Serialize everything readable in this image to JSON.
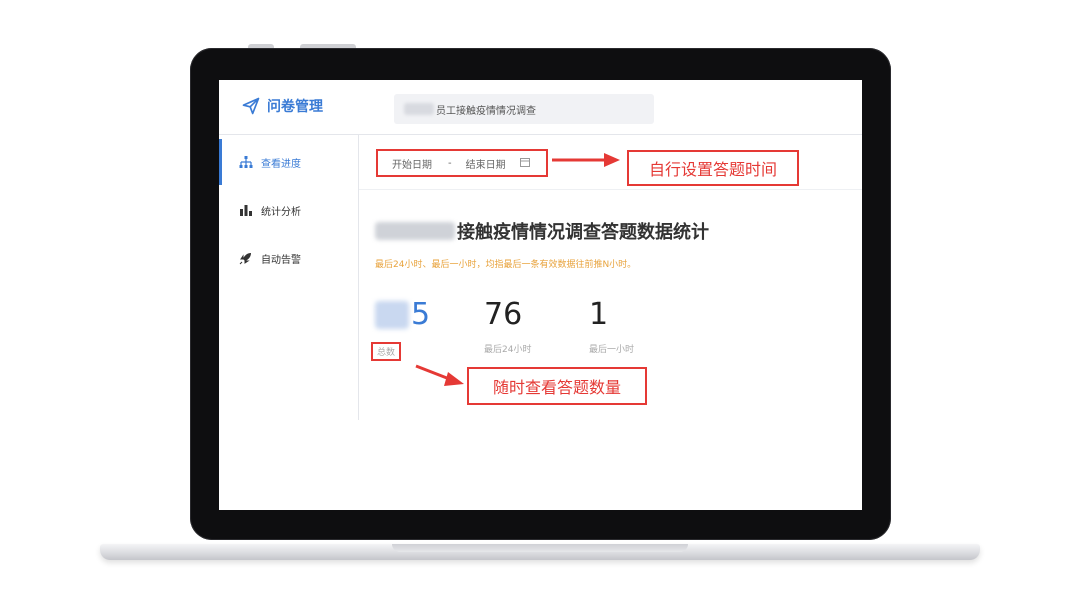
{
  "app": {
    "title": "问卷管理"
  },
  "search": {
    "value": "员工接触疫情情况调查"
  },
  "sidebar": {
    "items": [
      {
        "label": "查看进度",
        "icon": "sitemap-icon",
        "active": true
      },
      {
        "label": "统计分析",
        "icon": "bar-chart-icon",
        "active": false
      },
      {
        "label": "自动告警",
        "icon": "rocket-icon",
        "active": false
      }
    ]
  },
  "filter": {
    "start_placeholder": "开始日期",
    "separator": "-",
    "end_placeholder": "结束日期",
    "icon": "calendar-icon"
  },
  "main": {
    "title": "接触疫情情况调查答题数据统计",
    "hint": "最后24小时、最后一小时，均指最后一条有效数据往前推N小时。",
    "stats": [
      {
        "value": "5",
        "label": "总数"
      },
      {
        "value": "76",
        "label": "最后24小时"
      },
      {
        "value": "1",
        "label": "最后一小时"
      }
    ]
  },
  "annotations": {
    "date_callout": "自行设置答题时间",
    "count_callout": "随时查看答题数量"
  },
  "colors": {
    "accent": "#3a7bd5",
    "annotation_red": "#e53935",
    "hint_orange": "#e8a33d",
    "bezel": "#0e0e10"
  }
}
